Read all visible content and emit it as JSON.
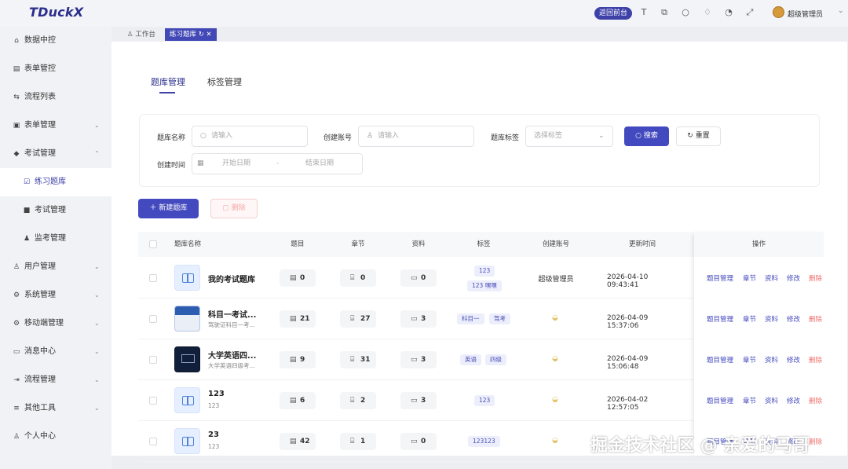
{
  "app": {
    "logo": "TDuckX"
  },
  "header": {
    "back_label": "返回前台",
    "user_name": "超级管理员",
    "icons": [
      "font-size-icon",
      "translate-icon",
      "search-icon",
      "shirt-icon",
      "notification-icon",
      "fullscreen-icon"
    ]
  },
  "tagsbar": {
    "tabs": [
      {
        "label": "工作台",
        "active": false
      },
      {
        "label": "练习题库",
        "active": true
      }
    ]
  },
  "sidebar": {
    "items": [
      {
        "label": "数据中控",
        "icon": "home-icon"
      },
      {
        "label": "表单管控",
        "icon": "form-icon"
      },
      {
        "label": "流程列表",
        "icon": "flow-icon"
      },
      {
        "label": "表单管理",
        "icon": "form-manage-icon",
        "expandable": true
      },
      {
        "label": "考试管理",
        "icon": "exam-icon",
        "expandable": true,
        "expanded": true
      },
      {
        "label": "练习题库",
        "icon": "practice-icon",
        "sub": true,
        "active": true
      },
      {
        "label": "考试管理",
        "icon": "exam-sub-icon",
        "sub": true
      },
      {
        "label": "监考管理",
        "icon": "proctor-icon",
        "sub": true
      },
      {
        "label": "用户管理",
        "icon": "user-icon",
        "expandable": true
      },
      {
        "label": "系统管理",
        "icon": "gear-icon",
        "expandable": true
      },
      {
        "label": "移动端管理",
        "icon": "mobile-icon",
        "expandable": true
      },
      {
        "label": "消息中心",
        "icon": "message-icon",
        "expandable": true
      },
      {
        "label": "流程管理",
        "icon": "process-icon",
        "expandable": true
      },
      {
        "label": "其他工具",
        "icon": "tools-icon",
        "expandable": true
      },
      {
        "label": "个人中心",
        "icon": "profile-icon"
      }
    ]
  },
  "page_tabs": [
    {
      "label": "题库管理",
      "active": true
    },
    {
      "label": "标签管理",
      "active": false
    }
  ],
  "filters": {
    "bank_name_label": "题库名称",
    "bank_name_placeholder": "请输入",
    "account_label": "创建账号",
    "account_placeholder": "请输入",
    "tag_label": "题库标签",
    "tag_placeholder": "选择标签",
    "time_label": "创建时间",
    "start_placeholder": "开始日期",
    "separator": "-",
    "end_placeholder": "结束日期",
    "search_label": "搜索",
    "reset_label": "重置"
  },
  "actions": {
    "new_label": "新建题库",
    "delete_label": "删除"
  },
  "table": {
    "columns": [
      "题库名称",
      "题目",
      "章节",
      "资料",
      "标签",
      "创建账号",
      "更新时间",
      "操作"
    ],
    "operations": [
      "题目管理",
      "章节",
      "资料",
      "修改",
      "删除"
    ],
    "rows": [
      {
        "name": "我的考试题库",
        "subtitle": "",
        "questions": "0",
        "chapters": "0",
        "materials": "0",
        "tags": [
          "123",
          "123 嘿嘿"
        ],
        "creator": "超级管理员",
        "updated": "2026-04-10 09:43:41"
      },
      {
        "name": "科目一考试...",
        "subtitle": "驾驶证科目一考...",
        "questions": "21",
        "chapters": "27",
        "materials": "3",
        "tags": [
          "科目一",
          "驾考"
        ],
        "creator": "",
        "updated": "2026-04-09 15:37:06"
      },
      {
        "name": "大学英语四...",
        "subtitle": "大学英语四级考...",
        "questions": "9",
        "chapters": "31",
        "materials": "3",
        "tags": [
          "英语",
          "四级"
        ],
        "creator": "",
        "updated": "2026-04-09 15:06:48"
      },
      {
        "name": "123",
        "subtitle": "123",
        "questions": "6",
        "chapters": "2",
        "materials": "3",
        "tags": [
          "123"
        ],
        "creator": "",
        "updated": "2026-04-02 12:57:05"
      },
      {
        "name": "23",
        "subtitle": "123",
        "questions": "42",
        "chapters": "1",
        "materials": "0",
        "tags": [
          "123123"
        ],
        "creator": "",
        "updated": ""
      }
    ]
  },
  "watermark": "掘金技术社区 @ 亲爱的马哥"
}
